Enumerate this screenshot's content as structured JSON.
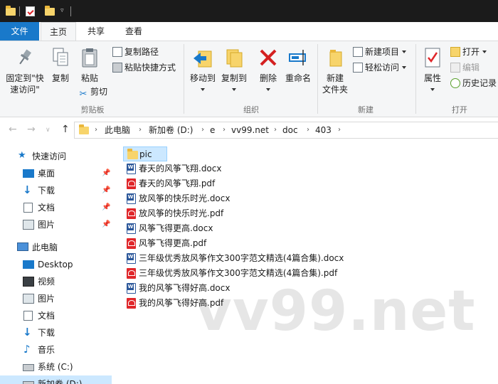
{
  "ribbon_tabs": {
    "file": "文件",
    "home": "主页",
    "share": "共享",
    "view": "查看"
  },
  "ribbon": {
    "clipboard": {
      "pin_quick_access": [
        "固定到\"快",
        "速访问\""
      ],
      "copy": "复制",
      "paste": "粘贴",
      "copy_path": "复制路径",
      "paste_shortcut": "粘贴快捷方式",
      "cut": "剪切",
      "group_label": "剪贴板"
    },
    "organize": {
      "move_to": "移动到",
      "copy_to": "复制到",
      "delete": "删除",
      "rename": "重命名",
      "group_label": "组织"
    },
    "new": {
      "new_folder": [
        "新建",
        "文件夹"
      ],
      "new_item": "新建项目",
      "easy_access": "轻松访问",
      "group_label": "新建"
    },
    "open": {
      "properties": "属性",
      "open": "打开",
      "edit": "编辑",
      "history": "历史记录",
      "group_label": "打开"
    }
  },
  "address": {
    "breadcrumbs": [
      "此电脑",
      "新加卷 (D:)",
      "e",
      "vv99.net",
      "doc",
      "403"
    ]
  },
  "sidebar": {
    "quick_access": "快速访问",
    "quick_items": [
      "桌面",
      "下载",
      "文档",
      "图片"
    ],
    "this_pc": "此电脑",
    "pc_items": [
      "Desktop",
      "视频",
      "图片",
      "文档",
      "下载",
      "音乐",
      "系统 (C:)",
      "新加卷 (D:)"
    ]
  },
  "files": [
    {
      "name": "pic",
      "type": "folder"
    },
    {
      "name": "春天的风筝飞翔.docx",
      "type": "doc"
    },
    {
      "name": "春天的风筝飞翔.pdf",
      "type": "pdf"
    },
    {
      "name": "放风筝的快乐时光.docx",
      "type": "doc"
    },
    {
      "name": "放风筝的快乐时光.pdf",
      "type": "pdf"
    },
    {
      "name": "风筝飞得更高.docx",
      "type": "doc"
    },
    {
      "name": "风筝飞得更高.pdf",
      "type": "pdf"
    },
    {
      "name": "三年级优秀放风筝作文300字范文精选(4篇合集).docx",
      "type": "doc"
    },
    {
      "name": "三年级优秀放风筝作文300字范文精选(4篇合集).pdf",
      "type": "pdf"
    },
    {
      "name": "我的风筝飞得好高.docx",
      "type": "doc"
    },
    {
      "name": "我的风筝飞得好高.pdf",
      "type": "pdf"
    }
  ],
  "watermark": "vv99.net",
  "colors": {
    "accent": "#1979ca",
    "selection": "#cce8ff",
    "folder": "#f7d46b",
    "pdf": "#e0262a",
    "word": "#2b579a"
  }
}
